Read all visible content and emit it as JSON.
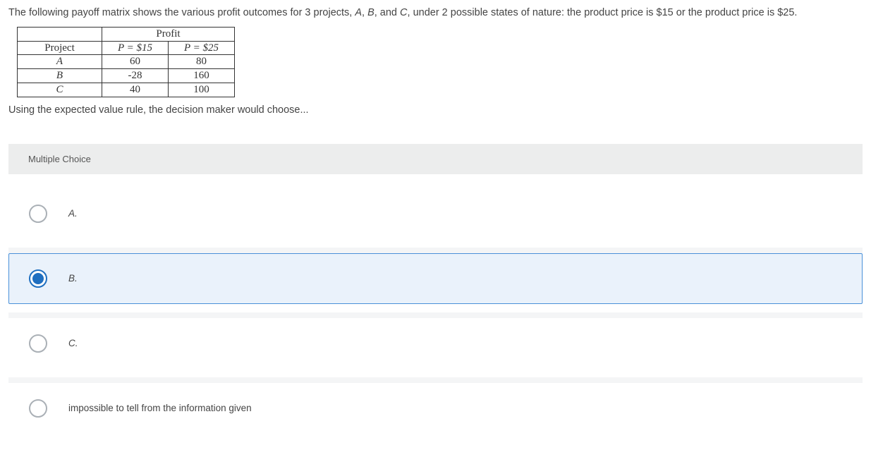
{
  "question": {
    "intro_before_A": "The following payoff matrix shows the various profit outcomes for 3 projects, ",
    "A": "A",
    "comma1": ", ",
    "B": "B",
    "comma2": ", and ",
    "C": "C",
    "after_C": ", under 2 possible states of nature:  the product price is $15 or the product price is $25."
  },
  "table": {
    "profit_header": "Profit",
    "project_header": "Project",
    "col1": "P = $15",
    "col2": "P = $25",
    "rows": [
      {
        "name": "A",
        "v1": "60",
        "v2": "80"
      },
      {
        "name": "B",
        "v1": "-28",
        "v2": "160"
      },
      {
        "name": "C",
        "v1": "40",
        "v2": "100"
      }
    ]
  },
  "follow": "Using the expected value rule, the decision maker would choose...",
  "mc_label": "Multiple Choice",
  "options": [
    {
      "label": "A.",
      "italic": true,
      "selected": false
    },
    {
      "label": "B.",
      "italic": true,
      "selected": true
    },
    {
      "label": "C.",
      "italic": true,
      "selected": false
    },
    {
      "label": "impossible to tell from the information given",
      "italic": false,
      "selected": false
    }
  ]
}
